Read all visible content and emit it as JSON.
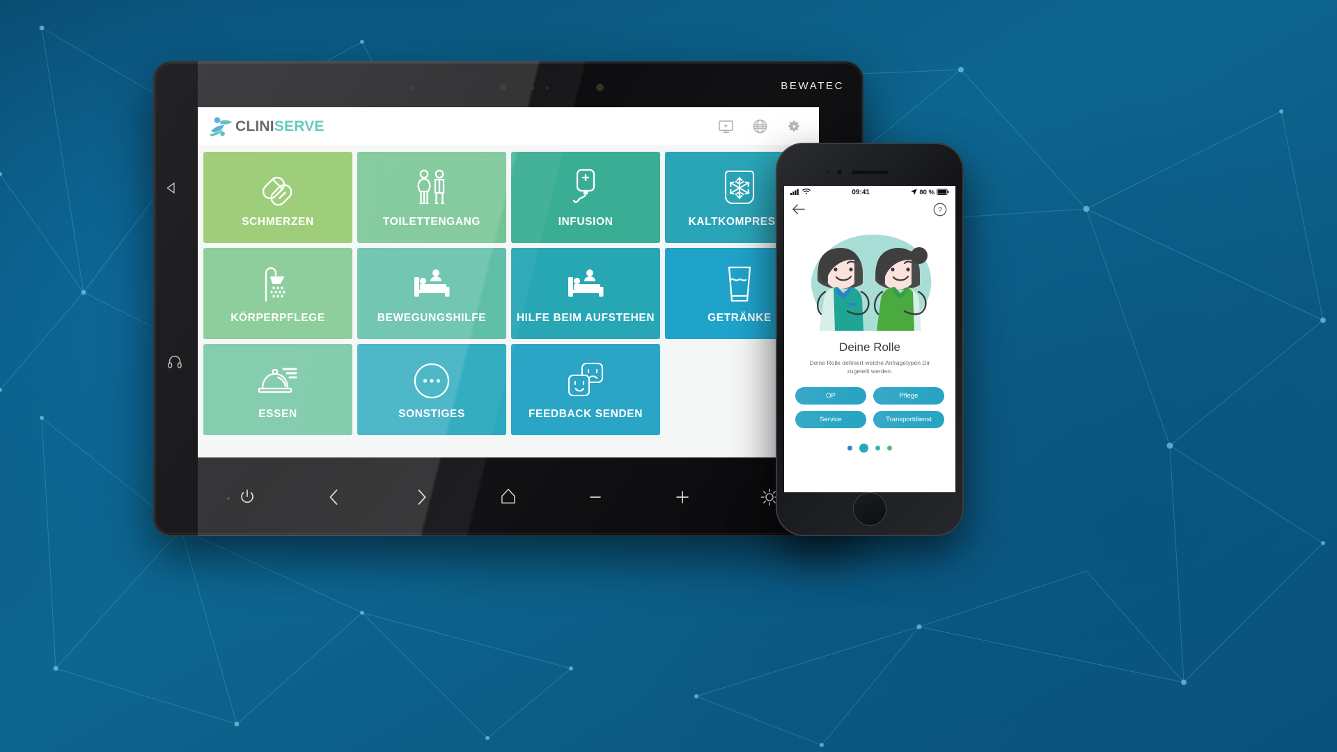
{
  "tablet": {
    "brand": "BEWATEC",
    "bezel_icons": [
      {
        "name": "back-triangle-icon"
      },
      {
        "name": "headphones-icon"
      }
    ],
    "controls": [
      {
        "name": "power-button",
        "label": "power"
      },
      {
        "name": "back-button",
        "label": "back"
      },
      {
        "name": "forward-button",
        "label": "forward"
      },
      {
        "name": "home-button",
        "label": "home"
      },
      {
        "name": "volume-down-button",
        "label": "minus"
      },
      {
        "name": "volume-up-button",
        "label": "plus"
      },
      {
        "name": "brightness-button",
        "label": "brightness"
      }
    ]
  },
  "app": {
    "logo": {
      "part1": "CLINI",
      "part2": "SERVE"
    },
    "header_icons": [
      {
        "name": "tv-video-icon",
        "label": "TV"
      },
      {
        "name": "globe-language-icon",
        "label": "Sprache"
      },
      {
        "name": "gear-settings-icon",
        "label": "Einstellungen"
      }
    ],
    "tiles": [
      {
        "label": "SCHMERZEN",
        "icon": "pills-icon",
        "color": "#8cc45f"
      },
      {
        "label": "TOILETTENGANG",
        "icon": "restroom-icon",
        "color": "#6ec08d"
      },
      {
        "label": "INFUSION",
        "icon": "iv-bag-icon",
        "color": "#3aae94"
      },
      {
        "label": "KALTKOMPRESSE",
        "icon": "snowflake-icon",
        "color": "#2aa5b8"
      },
      {
        "label": "KÖRPERPFLEGE",
        "icon": "shower-icon",
        "color": "#76c387"
      },
      {
        "label": "BEWEGUNGSHILFE",
        "icon": "bed-assist-icon",
        "color": "#57bca3"
      },
      {
        "label": "HILFE BEIM AUFSTEHEN",
        "icon": "bed-standup-icon",
        "color": "#27a7b4"
      },
      {
        "label": "GETRÄNKE",
        "icon": "water-glass-icon",
        "color": "#1fa3cb"
      },
      {
        "label": "ESSEN",
        "icon": "food-cloche-icon",
        "color": "#6cc29d"
      },
      {
        "label": "SONSTIGES",
        "icon": "ellipsis-icon",
        "color": "#2aa9bd"
      },
      {
        "label": "FEEDBACK SENDEN",
        "icon": "feedback-faces-icon",
        "color": "#2ba5c6"
      }
    ]
  },
  "phone": {
    "statusbar": {
      "signal": "signal-bars-icon",
      "wifi": "wifi-icon",
      "time": "09:41",
      "location": "location-arrow-icon",
      "battery_text": "80 %",
      "battery": "battery-icon"
    },
    "nav": {
      "back": "back-arrow-icon",
      "help": "?"
    },
    "illustration": "two-nurses-illustration",
    "title": "Deine Rolle",
    "subtitle": "Deine Rolle definiert welche Anfragetypen Dir zugeteilt werden.",
    "roles": [
      {
        "label": "OP"
      },
      {
        "label": "Pflege"
      },
      {
        "label": "Service"
      },
      {
        "label": "Transportdienst"
      }
    ],
    "pager": {
      "dots": [
        {
          "size": 7,
          "color": "#2e87c8",
          "active": false
        },
        {
          "size": 13,
          "color": "#2aa7c0",
          "active": true
        },
        {
          "size": 7,
          "color": "#35b5b0",
          "active": false
        },
        {
          "size": 7,
          "color": "#5bb86a",
          "active": false
        }
      ]
    }
  },
  "colors": {
    "brand_teal": "#45bfae",
    "brand_gray": "#4b4b4b",
    "phone_accent": "#2ba7c4",
    "bg_blue": "#0b5a86"
  }
}
